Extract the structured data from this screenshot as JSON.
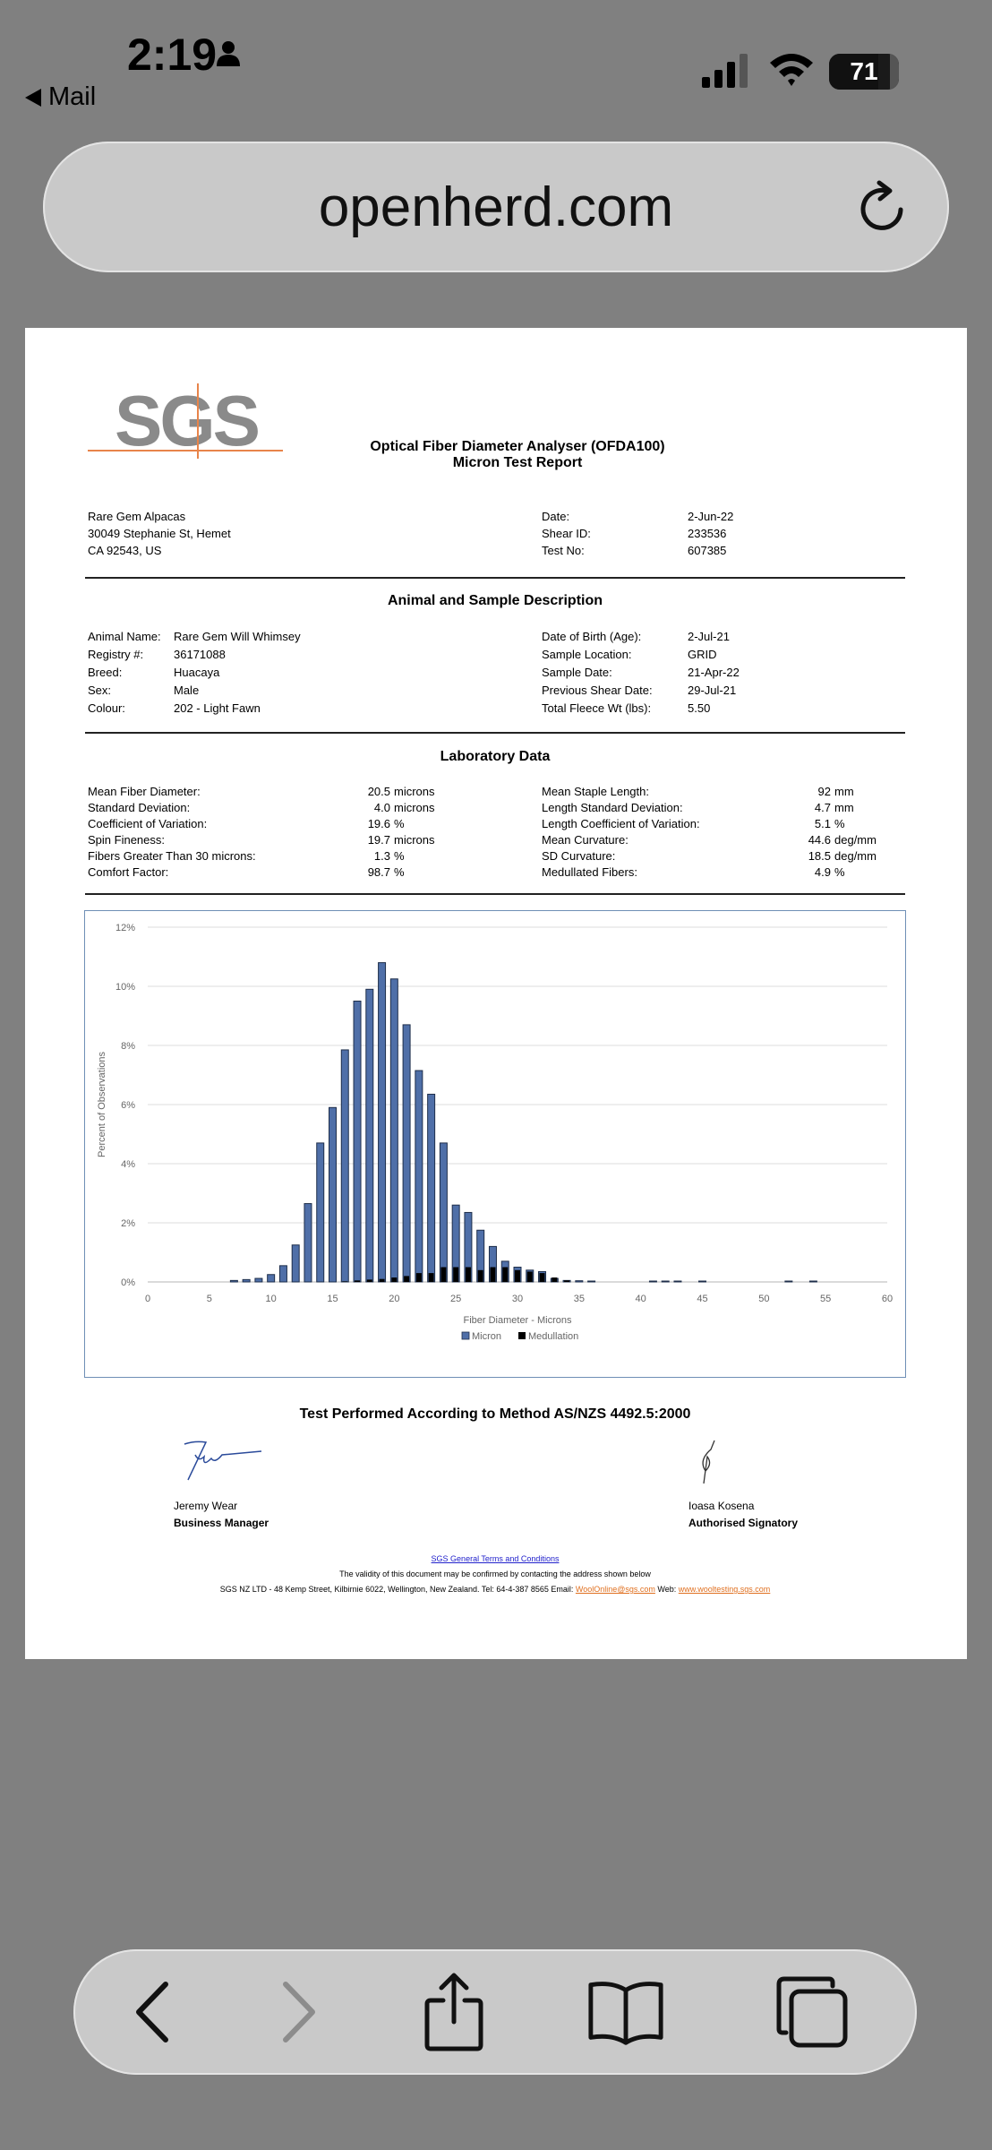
{
  "status_bar": {
    "time": "2:19",
    "back_label": "Mail",
    "battery_level": "71"
  },
  "browser": {
    "url": "openherd.com"
  },
  "report": {
    "logo_text": "SGS",
    "title_line1": "Optical Fiber Diameter Analyser (OFDA100)",
    "title_line2": "Micron Test Report",
    "client": {
      "name": "Rare Gem Alpacas",
      "street": "30049 Stephanie St, Hemet",
      "city": "CA 92543, US"
    },
    "meta": [
      {
        "label": "Date:",
        "value": "2-Jun-22"
      },
      {
        "label": "Shear ID:",
        "value": "233536"
      },
      {
        "label": "Test No:",
        "value": "607385"
      }
    ],
    "animal_section_title": "Animal and Sample Description",
    "animal_left": [
      {
        "label": "Animal Name:",
        "value": "Rare Gem Will Whimsey"
      },
      {
        "label": "Registry #:",
        "value": "36171088"
      },
      {
        "label": "Breed:",
        "value": "Huacaya"
      },
      {
        "label": "Sex:",
        "value": "Male"
      },
      {
        "label": "Colour:",
        "value": "202 - Light Fawn"
      }
    ],
    "animal_right": [
      {
        "label": "Date of Birth (Age):",
        "value": "2-Jul-21"
      },
      {
        "label": "Sample Location:",
        "value": "GRID"
      },
      {
        "label": "Sample Date:",
        "value": "21-Apr-22"
      },
      {
        "label": "Previous Shear Date:",
        "value": "29-Jul-21"
      },
      {
        "label": "Total Fleece Wt (lbs):",
        "value": "5.50"
      }
    ],
    "lab_section_title": "Laboratory Data",
    "lab_left": [
      {
        "label": "Mean Fiber Diameter:",
        "value": "20.5",
        "unit": "microns"
      },
      {
        "label": "Standard Deviation:",
        "value": "4.0",
        "unit": "microns"
      },
      {
        "label": "Coefficient of Variation:",
        "value": "19.6",
        "unit": "%"
      },
      {
        "label": "Spin Fineness:",
        "value": "19.7",
        "unit": "microns"
      },
      {
        "label": "Fibers Greater Than 30 microns:",
        "value": "1.3",
        "unit": "%"
      },
      {
        "label": "Comfort Factor:",
        "value": "98.7",
        "unit": "%"
      }
    ],
    "lab_right": [
      {
        "label": "Mean Staple Length:",
        "value": "92",
        "unit": "mm"
      },
      {
        "label": "Length Standard Deviation:",
        "value": "4.7",
        "unit": "mm"
      },
      {
        "label": "Length Coefficient of Variation:",
        "value": "5.1",
        "unit": "%"
      },
      {
        "label": "Mean Curvature:",
        "value": "44.6",
        "unit": "deg/mm"
      },
      {
        "label": "SD Curvature:",
        "value": "18.5",
        "unit": "deg/mm"
      },
      {
        "label": "Medullated Fibers:",
        "value": "4.9",
        "unit": "%"
      }
    ],
    "method_text": "Test Performed According to Method AS/NZS 4492.5:2000",
    "signatories": [
      {
        "name": "Jeremy Wear",
        "title": "Business Manager"
      },
      {
        "name": "Ioasa Kosena",
        "title": "Authorised Signatory"
      }
    ],
    "footer": {
      "terms_link": "SGS General Terms and Conditions",
      "validity": "The validity of this document may be confirmed by contacting the address shown below",
      "address": "SGS NZ LTD - 48 Kemp Street, Kilbirnie 6022, Wellington, New Zealand.  Tel: 64-4-387 8565 Email: ",
      "email": "WoolOnline@sgs.com",
      "web_label": " Web: ",
      "web": "www.wooltesting.sgs.com"
    }
  },
  "chart_data": {
    "type": "bar",
    "title": "",
    "xlabel": "Fiber Diameter - Microns",
    "ylabel": "Percent of Observations",
    "xlim": [
      0,
      60
    ],
    "ylim": [
      0,
      12
    ],
    "x_ticks": [
      0,
      5,
      10,
      15,
      20,
      25,
      30,
      35,
      40,
      45,
      50,
      55,
      60
    ],
    "y_ticks": [
      "0%",
      "2%",
      "4%",
      "6%",
      "8%",
      "10%",
      "12%"
    ],
    "legend": "bottom",
    "grid": true,
    "colors": {
      "Micron": "#4f6fa8",
      "Medullation": "#000000"
    },
    "x": [
      7,
      8,
      9,
      10,
      11,
      12,
      13,
      14,
      15,
      16,
      17,
      18,
      19,
      20,
      21,
      22,
      23,
      24,
      25,
      26,
      27,
      28,
      29,
      30,
      31,
      32,
      33,
      34,
      35,
      36,
      41,
      42,
      43,
      45,
      52,
      54
    ],
    "series": [
      {
        "name": "Micron",
        "values": [
          0.05,
          0.08,
          0.12,
          0.25,
          0.55,
          1.25,
          2.65,
          4.7,
          5.9,
          7.85,
          9.5,
          9.9,
          10.8,
          10.25,
          8.7,
          7.15,
          6.35,
          4.7,
          2.6,
          2.35,
          1.75,
          1.2,
          0.7,
          0.5,
          0.4,
          0.35,
          0.12,
          0.05,
          0.04,
          0.03,
          0.03,
          0.03,
          0.03,
          0.03,
          0.03,
          0.03
        ]
      },
      {
        "name": "Medullation",
        "values": [
          0,
          0,
          0,
          0,
          0,
          0,
          0,
          0,
          0,
          0.02,
          0.05,
          0.08,
          0.1,
          0.15,
          0.2,
          0.3,
          0.3,
          0.5,
          0.5,
          0.5,
          0.4,
          0.5,
          0.5,
          0.4,
          0.35,
          0.3,
          0.15,
          0.05,
          0,
          0,
          0,
          0,
          0,
          0,
          0,
          0
        ]
      }
    ]
  }
}
